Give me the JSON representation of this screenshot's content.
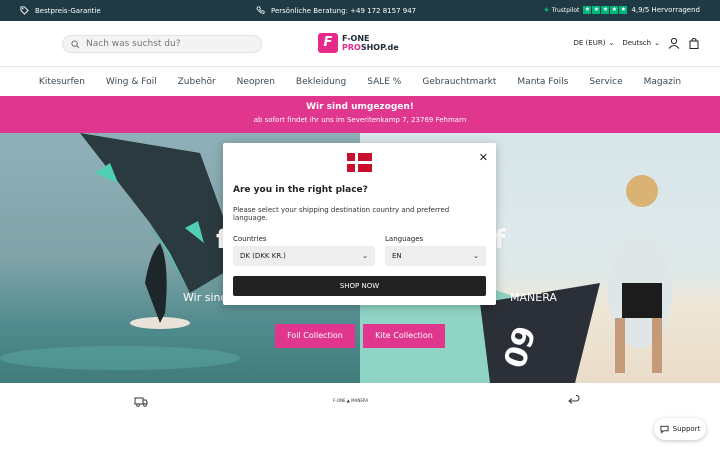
{
  "topbar": {
    "best_price": "Bestpreis-Garantie",
    "phone_label": "Persönliche Beratung: +49 172  8157 947",
    "trustpilot_name": "Trustpilot",
    "rating_text": "4,9/5 Hervorragend",
    "stars_count": 5
  },
  "header": {
    "search_placeholder": "Nach was suchst du?",
    "logo_line1": "F-ONE",
    "logo_line2a": "PRO",
    "logo_line2b": "SHOP.de",
    "currency": "DE (EUR)",
    "language": "Deutsch"
  },
  "nav": {
    "items": [
      "Kitesurfen",
      "Wing & Foil",
      "Zubehör",
      "Neopren",
      "Bekleidung",
      "SALE %",
      "Gebrauchtmarkt",
      "Manta Foils",
      "Service",
      "Magazin"
    ]
  },
  "banner": {
    "title": "Wir sind umgezogen!",
    "subtitle": "ab sofort findet ihr uns im Severitenkamp 7, 23769 Fehmarn"
  },
  "hero": {
    "left_text_fragment": "Wir sind",
    "right_text_fragment": "MANERA",
    "big_left": "f",
    "big_right": "f",
    "foil_button": "Foil Collection",
    "kite_button": "Kite Collection"
  },
  "bottom": {
    "brands": "F-ONE ▲  MANERA"
  },
  "support": {
    "label": "Support"
  },
  "modal": {
    "title": "Are you in the right place?",
    "description": "Please select your shipping destination country and preferred language.",
    "countries_label": "Countries",
    "countries_value": "DK (DKK KR.)",
    "languages_label": "Languages",
    "languages_value": "EN",
    "shop_button": "SHOP NOW"
  },
  "colors": {
    "accent": "#e0368e",
    "topbar": "#1f3a44",
    "trustpilot": "#00b67a",
    "flag_red": "#c8102e"
  }
}
